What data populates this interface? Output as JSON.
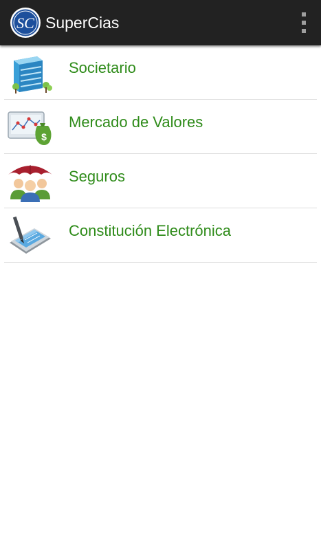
{
  "appbar": {
    "title": "SuperCias",
    "logo_text": "SC",
    "overflow_icon": "more-vert-icon"
  },
  "menu": {
    "items": [
      {
        "label": "Societario",
        "icon": "building-icon"
      },
      {
        "label": "Mercado de Valores",
        "icon": "chart-money-icon"
      },
      {
        "label": "Seguros",
        "icon": "umbrella-people-icon"
      },
      {
        "label": "Constitución Electrónica",
        "icon": "tablet-pen-icon"
      }
    ]
  },
  "colors": {
    "appbar": "#222222",
    "label": "#2e8b19",
    "divider": "#dcdcdc",
    "logo": "#1c4f9c"
  }
}
